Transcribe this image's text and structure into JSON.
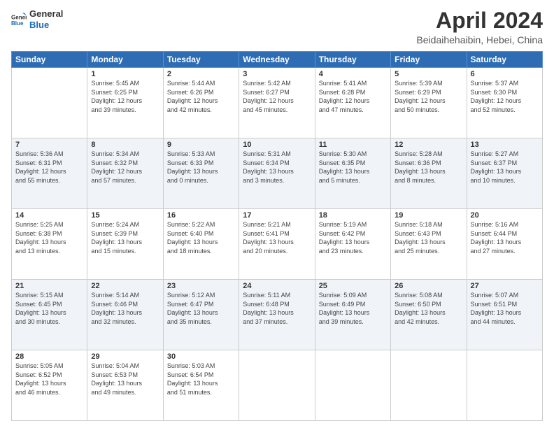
{
  "logo": {
    "line1": "General",
    "line2": "Blue"
  },
  "title": "April 2024",
  "subtitle": "Beidaihehaibin, Hebei, China",
  "header_days": [
    "Sunday",
    "Monday",
    "Tuesday",
    "Wednesday",
    "Thursday",
    "Friday",
    "Saturday"
  ],
  "weeks": [
    [
      {
        "day": "",
        "info": ""
      },
      {
        "day": "1",
        "info": "Sunrise: 5:45 AM\nSunset: 6:25 PM\nDaylight: 12 hours\nand 39 minutes."
      },
      {
        "day": "2",
        "info": "Sunrise: 5:44 AM\nSunset: 6:26 PM\nDaylight: 12 hours\nand 42 minutes."
      },
      {
        "day": "3",
        "info": "Sunrise: 5:42 AM\nSunset: 6:27 PM\nDaylight: 12 hours\nand 45 minutes."
      },
      {
        "day": "4",
        "info": "Sunrise: 5:41 AM\nSunset: 6:28 PM\nDaylight: 12 hours\nand 47 minutes."
      },
      {
        "day": "5",
        "info": "Sunrise: 5:39 AM\nSunset: 6:29 PM\nDaylight: 12 hours\nand 50 minutes."
      },
      {
        "day": "6",
        "info": "Sunrise: 5:37 AM\nSunset: 6:30 PM\nDaylight: 12 hours\nand 52 minutes."
      }
    ],
    [
      {
        "day": "7",
        "info": "Sunrise: 5:36 AM\nSunset: 6:31 PM\nDaylight: 12 hours\nand 55 minutes."
      },
      {
        "day": "8",
        "info": "Sunrise: 5:34 AM\nSunset: 6:32 PM\nDaylight: 12 hours\nand 57 minutes."
      },
      {
        "day": "9",
        "info": "Sunrise: 5:33 AM\nSunset: 6:33 PM\nDaylight: 13 hours\nand 0 minutes."
      },
      {
        "day": "10",
        "info": "Sunrise: 5:31 AM\nSunset: 6:34 PM\nDaylight: 13 hours\nand 3 minutes."
      },
      {
        "day": "11",
        "info": "Sunrise: 5:30 AM\nSunset: 6:35 PM\nDaylight: 13 hours\nand 5 minutes."
      },
      {
        "day": "12",
        "info": "Sunrise: 5:28 AM\nSunset: 6:36 PM\nDaylight: 13 hours\nand 8 minutes."
      },
      {
        "day": "13",
        "info": "Sunrise: 5:27 AM\nSunset: 6:37 PM\nDaylight: 13 hours\nand 10 minutes."
      }
    ],
    [
      {
        "day": "14",
        "info": "Sunrise: 5:25 AM\nSunset: 6:38 PM\nDaylight: 13 hours\nand 13 minutes."
      },
      {
        "day": "15",
        "info": "Sunrise: 5:24 AM\nSunset: 6:39 PM\nDaylight: 13 hours\nand 15 minutes."
      },
      {
        "day": "16",
        "info": "Sunrise: 5:22 AM\nSunset: 6:40 PM\nDaylight: 13 hours\nand 18 minutes."
      },
      {
        "day": "17",
        "info": "Sunrise: 5:21 AM\nSunset: 6:41 PM\nDaylight: 13 hours\nand 20 minutes."
      },
      {
        "day": "18",
        "info": "Sunrise: 5:19 AM\nSunset: 6:42 PM\nDaylight: 13 hours\nand 23 minutes."
      },
      {
        "day": "19",
        "info": "Sunrise: 5:18 AM\nSunset: 6:43 PM\nDaylight: 13 hours\nand 25 minutes."
      },
      {
        "day": "20",
        "info": "Sunrise: 5:16 AM\nSunset: 6:44 PM\nDaylight: 13 hours\nand 27 minutes."
      }
    ],
    [
      {
        "day": "21",
        "info": "Sunrise: 5:15 AM\nSunset: 6:45 PM\nDaylight: 13 hours\nand 30 minutes."
      },
      {
        "day": "22",
        "info": "Sunrise: 5:14 AM\nSunset: 6:46 PM\nDaylight: 13 hours\nand 32 minutes."
      },
      {
        "day": "23",
        "info": "Sunrise: 5:12 AM\nSunset: 6:47 PM\nDaylight: 13 hours\nand 35 minutes."
      },
      {
        "day": "24",
        "info": "Sunrise: 5:11 AM\nSunset: 6:48 PM\nDaylight: 13 hours\nand 37 minutes."
      },
      {
        "day": "25",
        "info": "Sunrise: 5:09 AM\nSunset: 6:49 PM\nDaylight: 13 hours\nand 39 minutes."
      },
      {
        "day": "26",
        "info": "Sunrise: 5:08 AM\nSunset: 6:50 PM\nDaylight: 13 hours\nand 42 minutes."
      },
      {
        "day": "27",
        "info": "Sunrise: 5:07 AM\nSunset: 6:51 PM\nDaylight: 13 hours\nand 44 minutes."
      }
    ],
    [
      {
        "day": "28",
        "info": "Sunrise: 5:05 AM\nSunset: 6:52 PM\nDaylight: 13 hours\nand 46 minutes."
      },
      {
        "day": "29",
        "info": "Sunrise: 5:04 AM\nSunset: 6:53 PM\nDaylight: 13 hours\nand 49 minutes."
      },
      {
        "day": "30",
        "info": "Sunrise: 5:03 AM\nSunset: 6:54 PM\nDaylight: 13 hours\nand 51 minutes."
      },
      {
        "day": "",
        "info": ""
      },
      {
        "day": "",
        "info": ""
      },
      {
        "day": "",
        "info": ""
      },
      {
        "day": "",
        "info": ""
      }
    ]
  ]
}
